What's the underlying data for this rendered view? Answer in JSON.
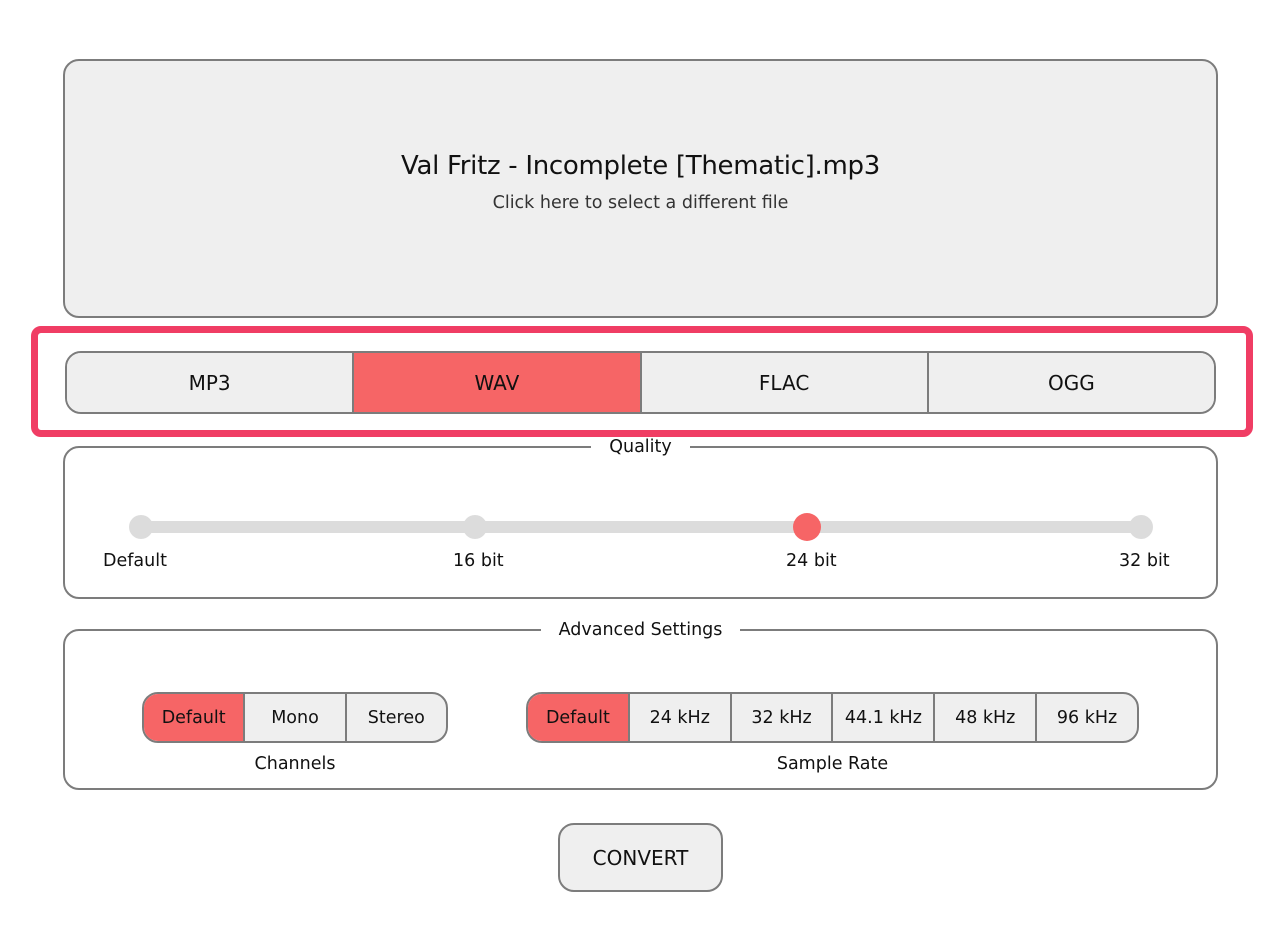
{
  "file": {
    "name": "Val Fritz - Incomplete [Thematic].mp3",
    "hint": "Click here to select a different file"
  },
  "formats": {
    "options": [
      "MP3",
      "WAV",
      "FLAC",
      "OGG"
    ],
    "selected": "WAV"
  },
  "quality": {
    "legend": "Quality",
    "options": [
      "Default",
      "16 bit",
      "24 bit",
      "32 bit"
    ],
    "selected": "24 bit"
  },
  "advanced": {
    "legend": "Advanced Settings",
    "channels": {
      "label": "Channels",
      "options": [
        "Default",
        "Mono",
        "Stereo"
      ],
      "selected": "Default"
    },
    "sample_rate": {
      "label": "Sample Rate",
      "options": [
        "Default",
        "24 kHz",
        "32 kHz",
        "44.1 kHz",
        "48 kHz",
        "96 kHz"
      ],
      "selected": "Default"
    }
  },
  "convert_label": "CONVERT",
  "colors": {
    "accent": "#f66566",
    "highlight": "#f03d64",
    "panel": "#efefef",
    "border": "#7c7c7c",
    "track": "#dcdcdc"
  }
}
